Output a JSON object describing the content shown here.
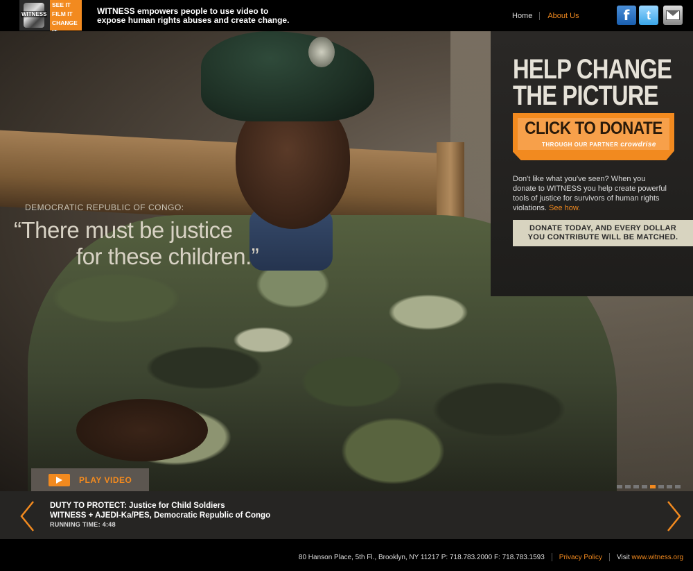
{
  "header": {
    "logo": {
      "brand": "WITNESS",
      "lines": [
        "SEE IT",
        "FILM IT",
        "CHANGE IT"
      ]
    },
    "tagline_line1": "WITNESS empowers people to use video to",
    "tagline_line2": "expose human rights abuses and create change.",
    "nav": {
      "home": "Home",
      "about": "About Us"
    },
    "social": {
      "facebook": "f",
      "twitter": "t"
    }
  },
  "hero": {
    "region": "DEMOCRATIC REPUBLIC OF CONGO:",
    "quote_line1": "“There must be justice",
    "quote_line2": "for these children.”",
    "play_label": "PLAY VIDEO",
    "slides_total": 8,
    "slides_active": 5
  },
  "donate": {
    "headline_line1": "HELP CHANGE",
    "headline_line2": "THE PICTURE",
    "button_title": "CLICK TO DONATE",
    "button_sub": "THROUGH OUR PARTNER",
    "partner": "crowdrise",
    "pitch": "Don't like what you've seen? When you donate to WITNESS you help create powerful tools of justice for survivors of human rights violations.",
    "see_how": "See how.",
    "match_line1": "DONATE TODAY, AND EVERY DOLLAR",
    "match_line2": "YOU CONTRIBUTE WILL BE MATCHED."
  },
  "video_info": {
    "title": "DUTY TO PROTECT: Justice for Child Soldiers",
    "subtitle": "WITNESS + AJEDI-Ka/PES, Democratic Republic of Congo",
    "running_time": "RUNNING TIME: 4:48"
  },
  "footer": {
    "address": "80 Hanson Place, 5th Fl., Brooklyn, NY 11217 P: 718.783.2000 F: 718.783.1593",
    "privacy": "Privacy Policy",
    "visit": "Visit",
    "url": "www.witness.org"
  },
  "colors": {
    "accent": "#f28a1f",
    "panel": "#2a2826",
    "infobar": "#262523"
  }
}
